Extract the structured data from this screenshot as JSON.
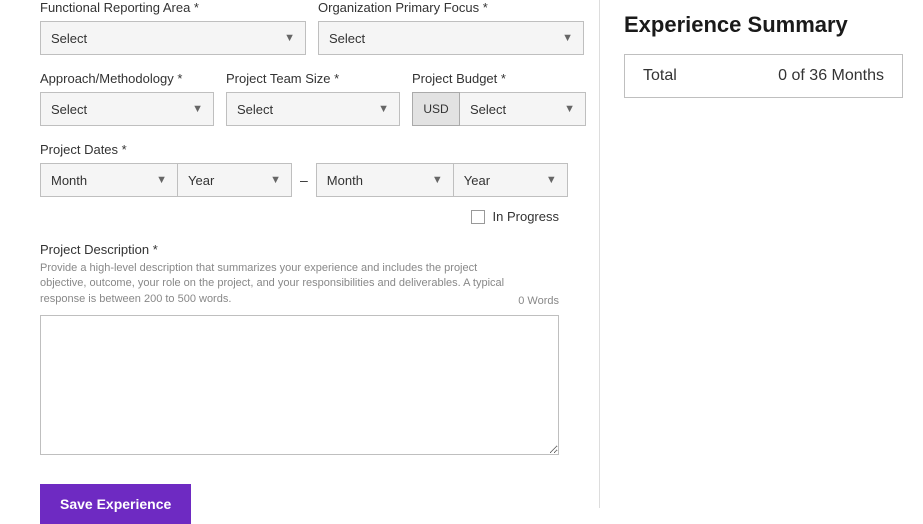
{
  "form": {
    "functional_area": {
      "label": "Functional Reporting Area *",
      "value": "Select"
    },
    "org_focus": {
      "label": "Organization Primary Focus *",
      "value": "Select"
    },
    "approach": {
      "label": "Approach/Methodology *",
      "value": "Select"
    },
    "team_size": {
      "label": "Project Team Size *",
      "value": "Select"
    },
    "budget": {
      "label": "Project Budget *",
      "currency": "USD",
      "value": "Select"
    },
    "dates": {
      "label": "Project Dates *",
      "start_month": "Month",
      "start_year": "Year",
      "end_month": "Month",
      "end_year": "Year",
      "separator": "–"
    },
    "in_progress_label": "In Progress",
    "description": {
      "label": "Project Description *",
      "help": "Provide a high-level description that summarizes your experience and includes the project objective, outcome, your role on the project, and your responsibilities and deliverables. A typical response is between 200 to 500 words.",
      "word_count": "0 Words"
    },
    "save_label": "Save Experience"
  },
  "summary": {
    "title": "Experience Summary",
    "total_label": "Total",
    "total_value": "0 of 36 Months"
  }
}
